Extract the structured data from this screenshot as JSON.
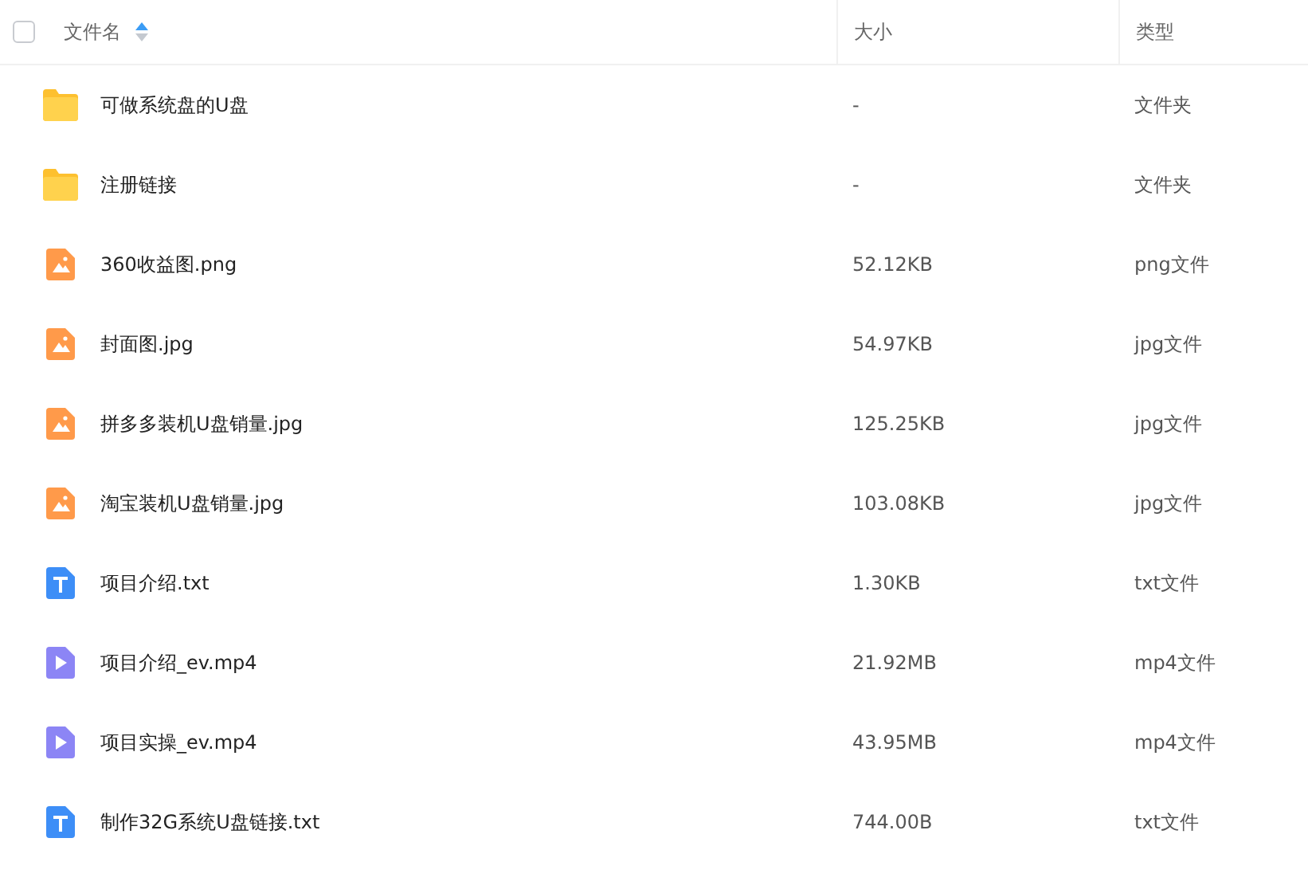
{
  "table": {
    "select_all": {
      "checked": false
    },
    "columns": [
      {
        "label": "文件名",
        "sorted_ascending": true
      },
      {
        "label": "大小"
      },
      {
        "label": "类型"
      }
    ],
    "rows": [
      {
        "kind": "folder",
        "name": "可做系统盘的U盘",
        "size": "-",
        "type": "文件夹"
      },
      {
        "kind": "folder",
        "name": "注册链接",
        "size": "-",
        "type": "文件夹"
      },
      {
        "kind": "image",
        "name": "360收益图.png",
        "size": "52.12KB",
        "type": "png文件"
      },
      {
        "kind": "image",
        "name": "封面图.jpg",
        "size": "54.97KB",
        "type": "jpg文件"
      },
      {
        "kind": "image",
        "name": "拼多多装机U盘销量.jpg",
        "size": "125.25KB",
        "type": "jpg文件"
      },
      {
        "kind": "image",
        "name": "淘宝装机U盘销量.jpg",
        "size": "103.08KB",
        "type": "jpg文件"
      },
      {
        "kind": "text",
        "name": "项目介绍.txt",
        "size": "1.30KB",
        "type": "txt文件"
      },
      {
        "kind": "video",
        "name": "项目介绍_ev.mp4",
        "size": "21.92MB",
        "type": "mp4文件"
      },
      {
        "kind": "video",
        "name": "项目实操_ev.mp4",
        "size": "43.95MB",
        "type": "mp4文件"
      },
      {
        "kind": "text",
        "name": "制作32G系统U盘链接.txt",
        "size": "744.00B",
        "type": "txt文件"
      }
    ]
  }
}
